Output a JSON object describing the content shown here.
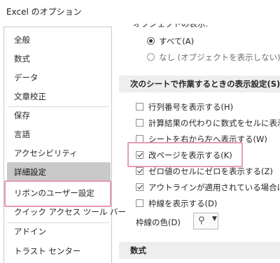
{
  "window": {
    "title": "Excel のオプション"
  },
  "sidebar": {
    "items": [
      {
        "label": "全般"
      },
      {
        "label": "数式"
      },
      {
        "label": "データ"
      },
      {
        "label": "文章校正"
      },
      {
        "label": "保存"
      },
      {
        "label": "言語"
      },
      {
        "label": "アクセシビリティ"
      },
      {
        "label": "詳細設定",
        "selected": true
      },
      {
        "label": "リボンのユーザー設定"
      },
      {
        "label": "クイック アクセス ツール バー"
      },
      {
        "label": "アドイン"
      },
      {
        "label": "トラスト センター"
      }
    ]
  },
  "content": {
    "top_partial_label": "オブジェクトの表示:",
    "radio_all": "すべて(A)",
    "radio_none": "なし (オブジェクトを表示しない)(D)",
    "sheet_section_title": "次のシートで作業するときの表示設定(S):",
    "options": [
      {
        "label": "行列番号を表示する(H)",
        "checked": false
      },
      {
        "label": "計算結果の代わりに数式をセルに表示する",
        "checked": false
      },
      {
        "label": "シートを右から左へ表示する(W)",
        "checked": false
      },
      {
        "label": "改ページを表示する(K)",
        "checked": true
      },
      {
        "label": "ゼロ値のセルにゼロを表示する(Z)",
        "checked": true
      },
      {
        "label": "アウトラインが適用されている場合はアウ",
        "checked": true
      },
      {
        "label": "枠線を表示する(D)",
        "checked": false
      }
    ],
    "gridline_color_label": "枠線の色(D)",
    "formulas_section_title": "数式"
  },
  "colors": {
    "highlight": "#e89ab4",
    "selected_bg": "#c9c9c9",
    "section_bg": "#eeeeee"
  }
}
